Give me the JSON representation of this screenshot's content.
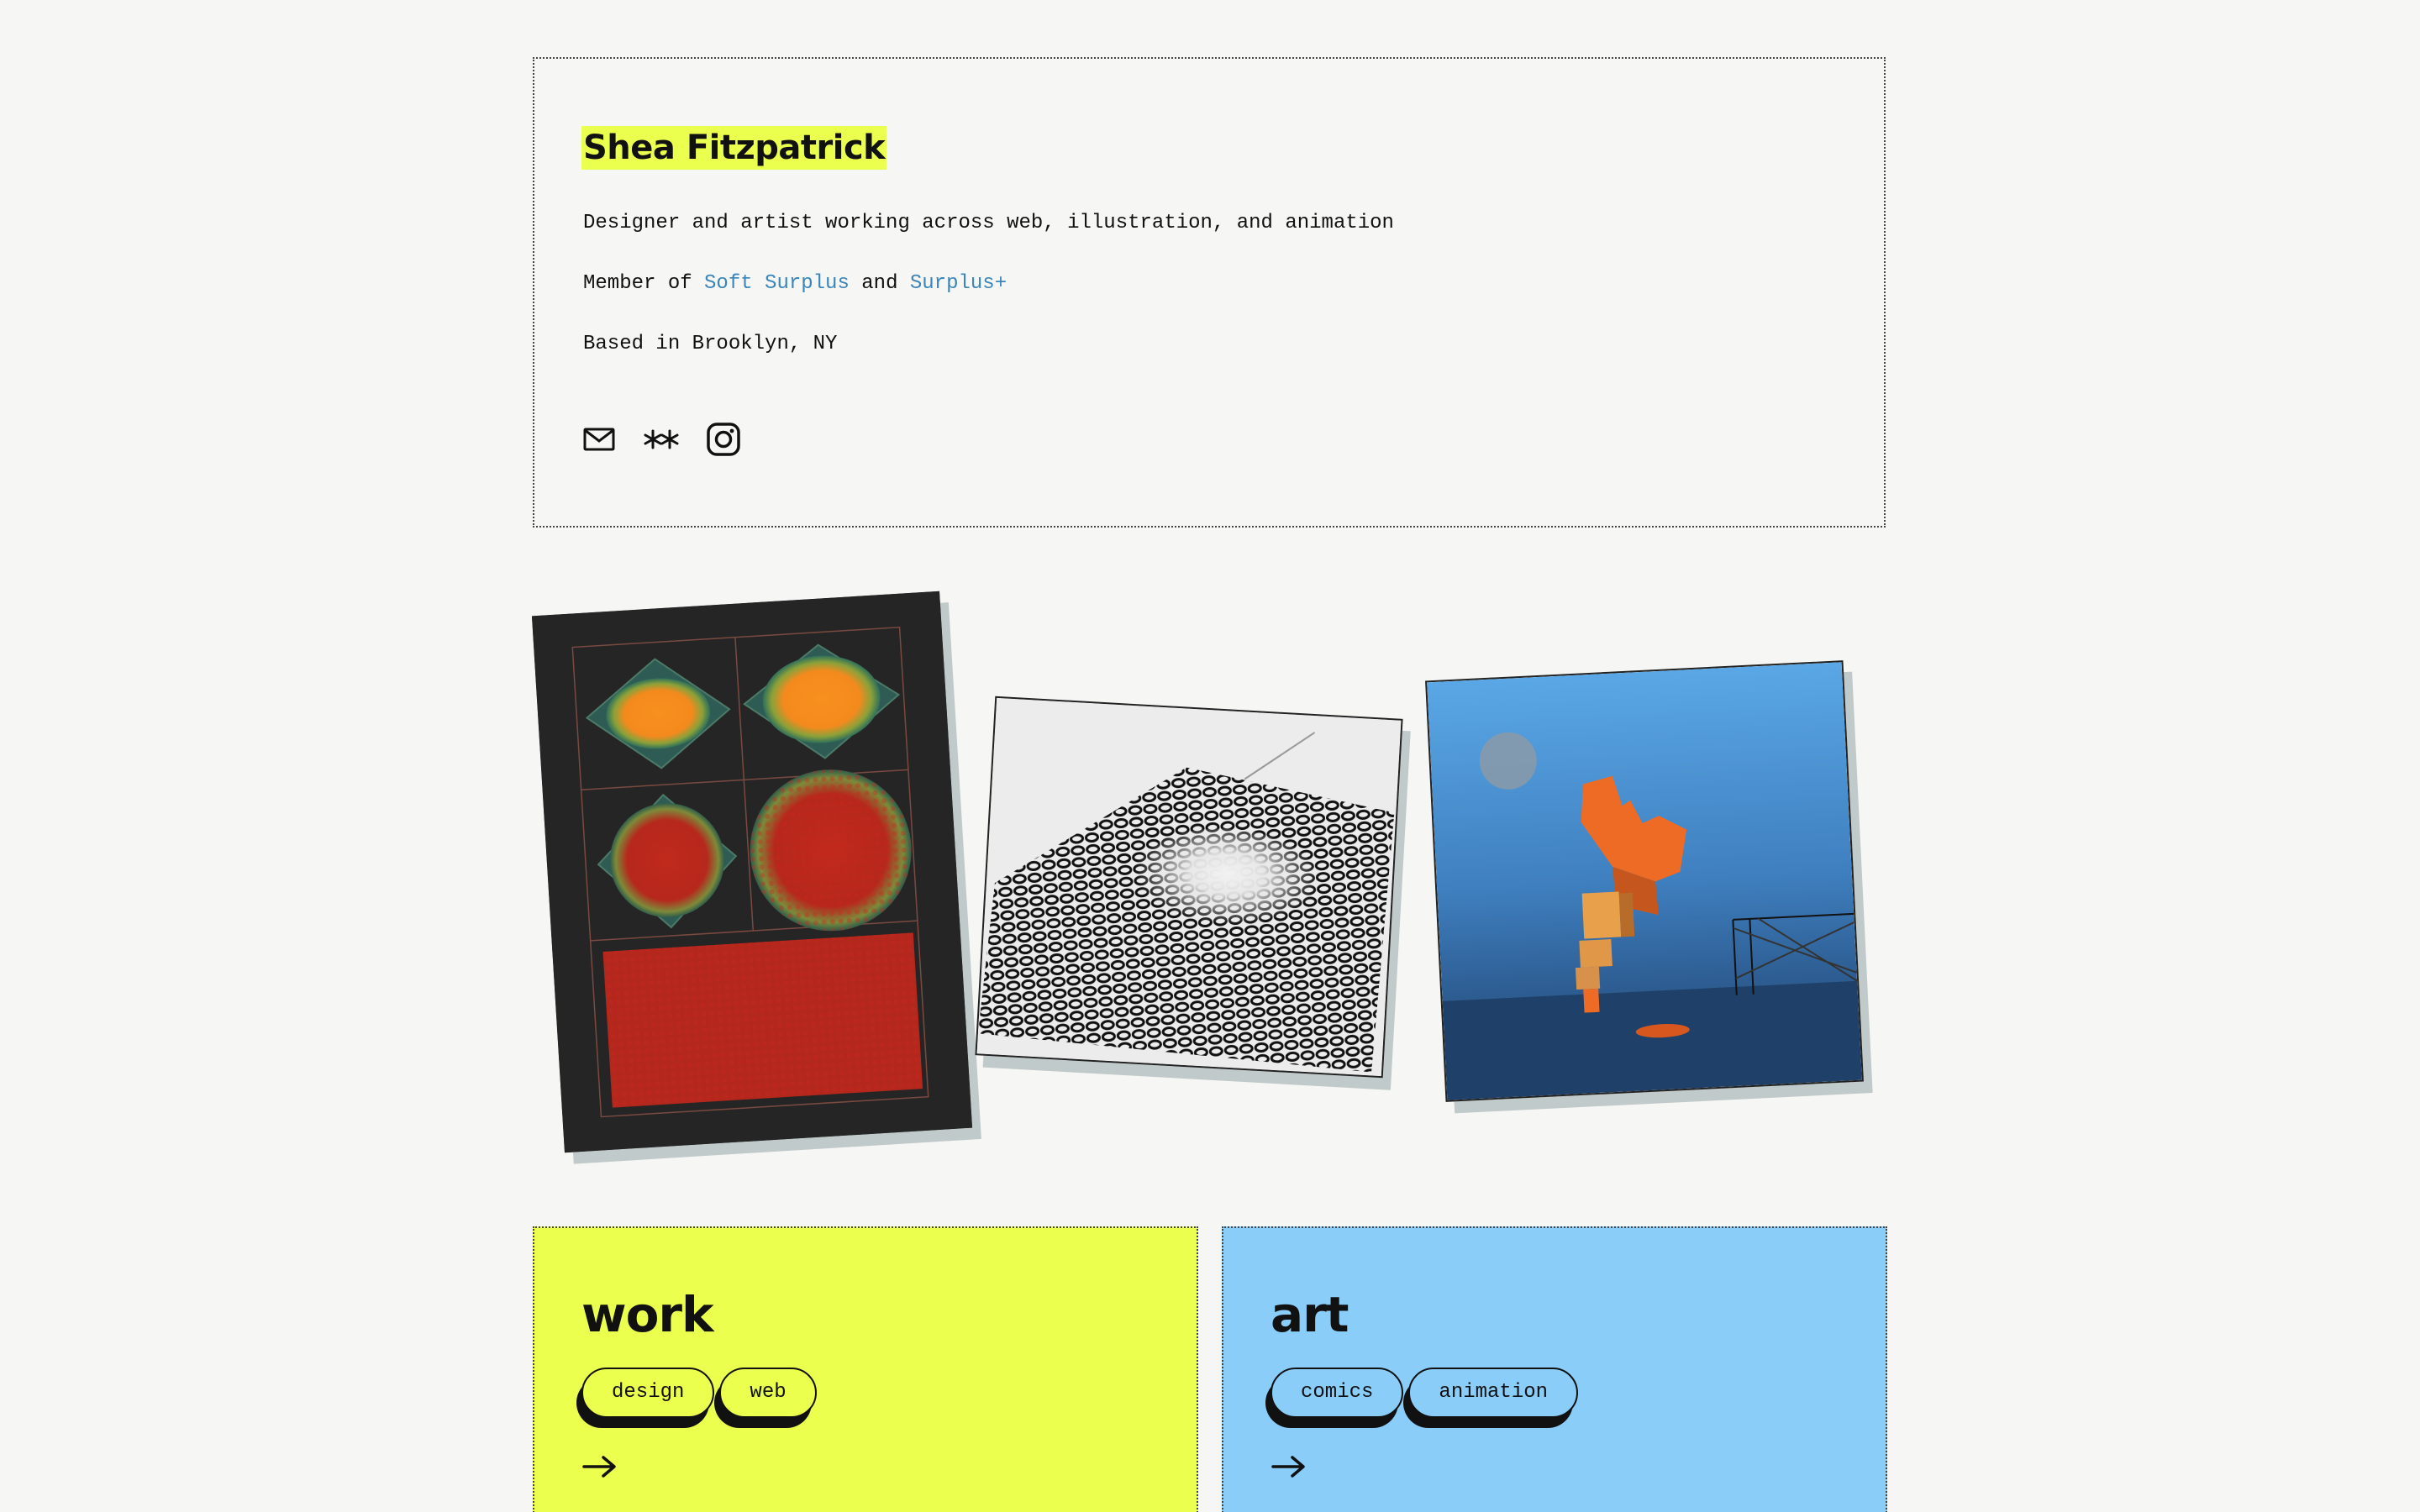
{
  "intro": {
    "name": "Shea Fitzpatrick",
    "tagline": "Designer and artist working across web, illustration, and animation",
    "member_prefix": "Member of ",
    "member_link_1": "Soft Surplus",
    "member_and": " and ",
    "member_link_2": "Surplus+",
    "location": "Based in Brooklyn, NY",
    "socials": [
      {
        "icon": "mail-icon",
        "label": "Email"
      },
      {
        "icon": "asterisks-icon",
        "label": "Are.na"
      },
      {
        "icon": "instagram-icon",
        "label": "Instagram"
      }
    ]
  },
  "gallery": {
    "images": [
      {
        "name": "orange-red-halftone-grid-image"
      },
      {
        "name": "black-white-mesh-render-image"
      },
      {
        "name": "orange-blocks-blue-sky-image"
      }
    ]
  },
  "sections": {
    "work": {
      "title": "work",
      "tags": [
        "design",
        "web"
      ],
      "color": "#ebff4f"
    },
    "art": {
      "title": "art",
      "tags": [
        "comics",
        "animation"
      ],
      "color": "#8bcdf9"
    }
  },
  "colors": {
    "background": "#f6f6f5",
    "highlight": "#ebff4f",
    "link": "#3a85b9",
    "art_blue": "#8bcdf9"
  }
}
